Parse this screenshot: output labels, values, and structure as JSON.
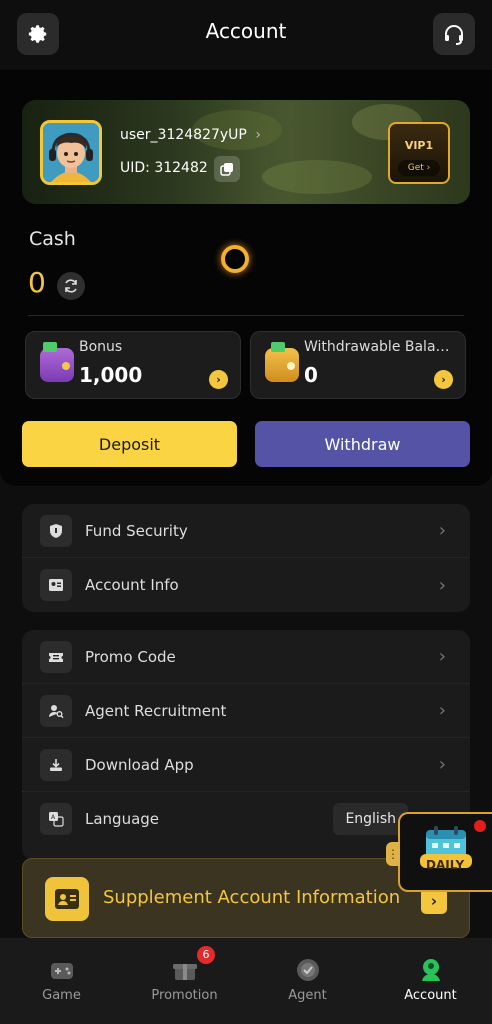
{
  "header": {
    "title": "Account",
    "settings_icon": "gear-icon",
    "support_icon": "headset-icon"
  },
  "profile": {
    "username": "user_3124827yUP",
    "username_chevron": "›",
    "uid_label": "UID: 312482",
    "vip": {
      "label": "VIP1",
      "action": "Get ›"
    }
  },
  "cash": {
    "label": "Cash",
    "value": "0"
  },
  "balances": [
    {
      "label": "Bonus",
      "value": "1,000",
      "icon": "purple-wallet-icon"
    },
    {
      "label": "Withdrawable Balan...",
      "value": "0",
      "icon": "gold-wallet-icon"
    }
  ],
  "actions": {
    "deposit": "Deposit",
    "withdraw": "Withdraw"
  },
  "menu_group_1": [
    {
      "label": "Fund Security",
      "icon": "shield-icon"
    },
    {
      "label": "Account Info",
      "icon": "id-card-icon"
    }
  ],
  "menu_group_2": [
    {
      "label": "Promo Code",
      "icon": "ticket-icon"
    },
    {
      "label": "Agent Recruitment",
      "icon": "user-search-icon"
    },
    {
      "label": "Download App",
      "icon": "download-icon"
    },
    {
      "label": "Language",
      "icon": "translate-icon",
      "value": "English"
    }
  ],
  "supplement": {
    "label": "Supplement Account Information",
    "action": "›"
  },
  "daily": {
    "label": "DAILY"
  },
  "bottom_nav": [
    {
      "label": "Game",
      "icon": "gamepad-icon",
      "active": false
    },
    {
      "label": "Promotion",
      "icon": "gift-box-icon",
      "badge": "6",
      "active": false
    },
    {
      "label": "Agent",
      "icon": "agent-icon",
      "active": false
    },
    {
      "label": "Account",
      "icon": "account-icon",
      "active": true
    }
  ],
  "colors": {
    "accent_yellow": "#fbd443",
    "withdraw_purple": "#5553a6",
    "active_green": "#27c35a"
  }
}
